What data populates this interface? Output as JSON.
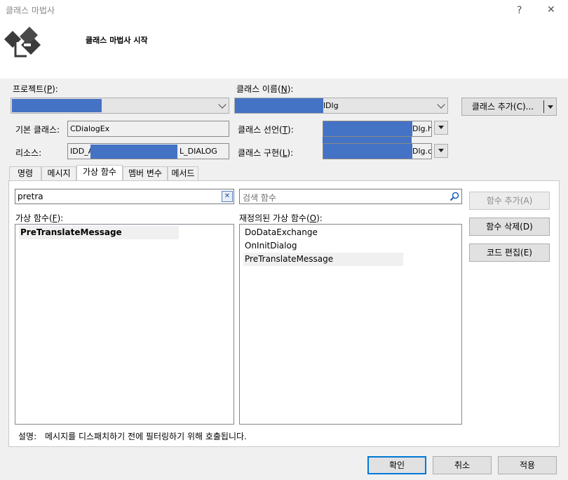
{
  "window": {
    "title": "클래스 마법사",
    "help": "?",
    "close": "✕"
  },
  "header": {
    "subtitle": "클래스 마법사 시작"
  },
  "project": {
    "label": "프로젝트(",
    "key": "P",
    "label_end": "):",
    "value": ""
  },
  "class_name": {
    "label": "클래스 이름(",
    "key": "N",
    "label_end": "):",
    "value_suffix": "lDlg"
  },
  "add_class_button": {
    "label": "클래스 추가(C)..."
  },
  "base_class": {
    "label": "기본 클래스:",
    "value": "CDialogEx"
  },
  "class_declaration": {
    "label": "클래스 선언(",
    "key": "T",
    "label_end": "):",
    "value_suffix": "Dlg.h"
  },
  "resource": {
    "label": "리소스:",
    "value_prefix": "IDD_A",
    "value_suffix": "L_DIALOG"
  },
  "class_implementation": {
    "label": "클래스 구현(",
    "key": "L",
    "label_end": "):",
    "value_suffix": "Dlg.c"
  },
  "tabs": [
    "명령",
    "메시지",
    "가상 함수",
    "멤버 변수",
    "메서드"
  ],
  "search": {
    "left_value": "pretra",
    "right_placeholder": "검색 함수",
    "clear_icon": "✕"
  },
  "virtual_functions": {
    "label": "가상 함수(",
    "key": "F",
    "label_end": "):",
    "items": [
      "PreTranslateMessage"
    ]
  },
  "overridden_functions": {
    "label": "재정의된 가상 함수(",
    "key": "O",
    "label_end": "):",
    "items": [
      "DoDataExchange",
      "OnInitDialog",
      "PreTranslateMessage"
    ]
  },
  "side_buttons": {
    "add_function": "함수 추가(A)",
    "delete_function": "함수 삭제(D)",
    "edit_code": "코드 편집(E)"
  },
  "description": {
    "label": "설명:",
    "text": "메시지를 디스패치하기 전에 필터링하기 위해 호출됩니다."
  },
  "footer": {
    "ok": "확인",
    "cancel": "취소",
    "apply": "적용"
  },
  "colors": {
    "redaction": "#4472c4",
    "accent": "#0078d7"
  }
}
